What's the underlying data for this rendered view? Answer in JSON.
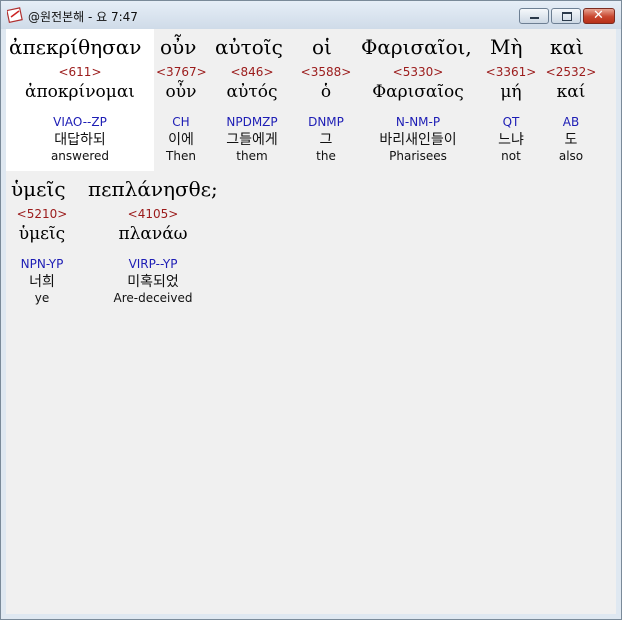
{
  "window": {
    "title": "@원전본해 - 요 7:47",
    "controls": {
      "minimize_icon": "minimize-icon",
      "maximize_icon": "maximize-icon",
      "close_icon": "close-icon"
    }
  },
  "verse": {
    "lines": [
      {
        "words": [
          {
            "greek": "ἀπεκρίθησαν",
            "strong": "<611>",
            "lemma": "ἀποκρίνομαι",
            "morph": "VIAO--ZP",
            "korean": "대답하되",
            "english": "answered"
          },
          {
            "greek": "οὖν",
            "strong": "<3767>",
            "lemma": "οὖν",
            "morph": "CH",
            "korean": "이에",
            "english": "Then"
          },
          {
            "greek": "αὐτοῖς",
            "strong": "<846>",
            "lemma": "αὐτός",
            "morph": "NPDMZP",
            "korean": "그들에게",
            "english": "them"
          },
          {
            "greek": "οἱ",
            "strong": "<3588>",
            "lemma": "ὁ",
            "morph": "DNMP",
            "korean": "그",
            "english": "the"
          },
          {
            "greek": "Φαρισαῖοι,",
            "strong": "<5330>",
            "lemma": "Φαρισαῖος",
            "morph": "N-NM-P",
            "korean": "바리새인들이",
            "english": "Pharisees"
          },
          {
            "greek": "Μὴ",
            "strong": "<3361>",
            "lemma": "μή",
            "morph": "QT",
            "korean": "느냐",
            "english": "not"
          },
          {
            "greek": "καὶ",
            "strong": "<2532>",
            "lemma": "καί",
            "morph": "AB",
            "korean": "도",
            "english": "also"
          }
        ]
      },
      {
        "words": [
          {
            "greek": "ὑμεῖς",
            "strong": "<5210>",
            "lemma": "ὑμεῖς",
            "morph": "NPN-YP",
            "korean": "너희",
            "english": "ye"
          },
          {
            "greek": "πεπλάνησθε;",
            "strong": "<4105>",
            "lemma": "πλανάω",
            "morph": "VIRP--YP",
            "korean": "미혹되었",
            "english": "Are-deceived"
          }
        ]
      }
    ]
  },
  "colors": {
    "strong": "#9b1b1b",
    "morph": "#1d1db5",
    "selected_bg": "#ffffff",
    "panel_bg": "#f0f0f0"
  }
}
